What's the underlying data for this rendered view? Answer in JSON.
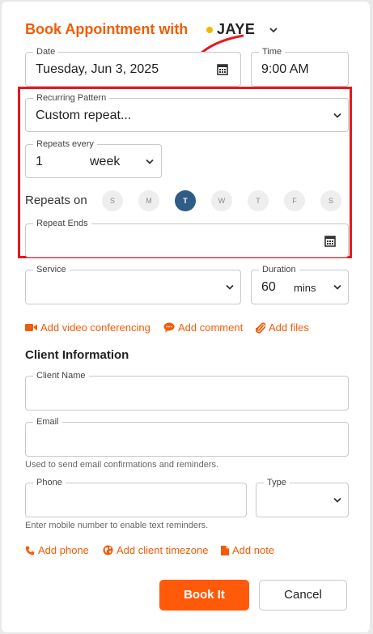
{
  "header": {
    "title": "Book Appointment with",
    "staff_name": "JAYE",
    "staff_dot_color": "#f2b705"
  },
  "date": {
    "label": "Date",
    "value": "Tuesday, Jun 3, 2025",
    "icon": "calendar-icon"
  },
  "time": {
    "label": "Time",
    "value": "9:00 AM"
  },
  "recurring": {
    "label": "Recurring Pattern",
    "value": "Custom repeat..."
  },
  "repeats_every": {
    "label": "Repeats every",
    "number": "1",
    "unit": "week"
  },
  "repeats_on": {
    "label": "Repeats on",
    "days": [
      "S",
      "M",
      "T",
      "W",
      "T",
      "F",
      "S"
    ],
    "selected_index": 2
  },
  "repeat_ends": {
    "label": "Repeat Ends",
    "value": ""
  },
  "service": {
    "label": "Service",
    "value": ""
  },
  "duration": {
    "label": "Duration",
    "value": "60",
    "unit": "mins"
  },
  "links_top": {
    "video": "Add video conferencing",
    "comment": "Add comment",
    "files": "Add files"
  },
  "client": {
    "section_title": "Client Information",
    "name_label": "Client Name",
    "email_label": "Email",
    "email_hint": "Used to send email confirmations and reminders.",
    "phone_label": "Phone",
    "phone_hint": "Enter mobile number to enable text reminders.",
    "type_label": "Type"
  },
  "links_bottom": {
    "phone": "Add phone",
    "timezone": "Add client timezone",
    "note": "Add note"
  },
  "buttons": {
    "primary": "Book It",
    "secondary": "Cancel"
  },
  "colors": {
    "accent": "#f25c05",
    "primary_button": "#ff5a0a",
    "selected_day": "#2f5c85",
    "annotation": "#e5191f"
  }
}
